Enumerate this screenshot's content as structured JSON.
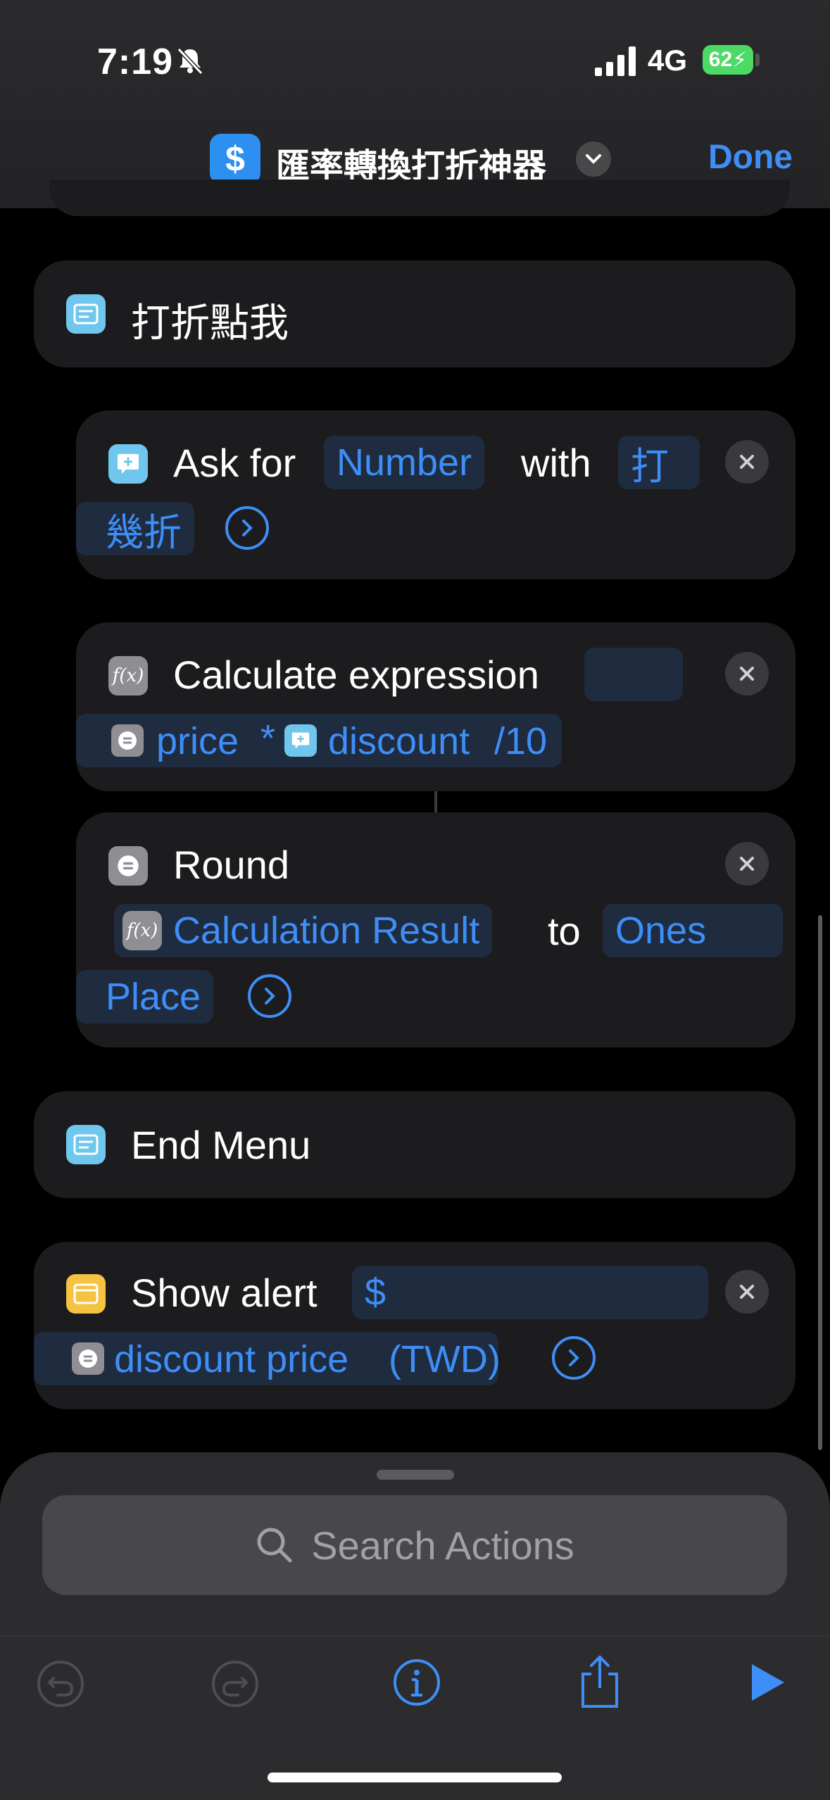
{
  "status": {
    "time": "7:19",
    "network": "4G",
    "battery": "62"
  },
  "nav": {
    "app_title": "匯率轉換打折神器",
    "app_icon_glyph": "$",
    "done_label": "Done"
  },
  "actions": {
    "menu_item": {
      "label": "打折點我"
    },
    "ask": {
      "label": "Ask for",
      "type": "Number",
      "with": "with",
      "prompt_part1": "打",
      "prompt_part2": "幾折"
    },
    "calc": {
      "label": "Calculate expression",
      "var1": "price",
      "op": "*",
      "var2": "discount",
      "suffix": "/10"
    },
    "round": {
      "label": "Round",
      "input": "Calculation Result",
      "to": "to",
      "place_part1": "Ones",
      "place_part2": "Place"
    },
    "end_menu": {
      "label": "End Menu"
    },
    "alert": {
      "label": "Show alert",
      "prefix": "$",
      "var": "discount price",
      "suffix": "(TWD)"
    }
  },
  "search": {
    "placeholder": "Search Actions"
  },
  "colors": {
    "accent": "#3e8ef7",
    "battery": "#4cd964",
    "card": "#1c1c1e"
  }
}
